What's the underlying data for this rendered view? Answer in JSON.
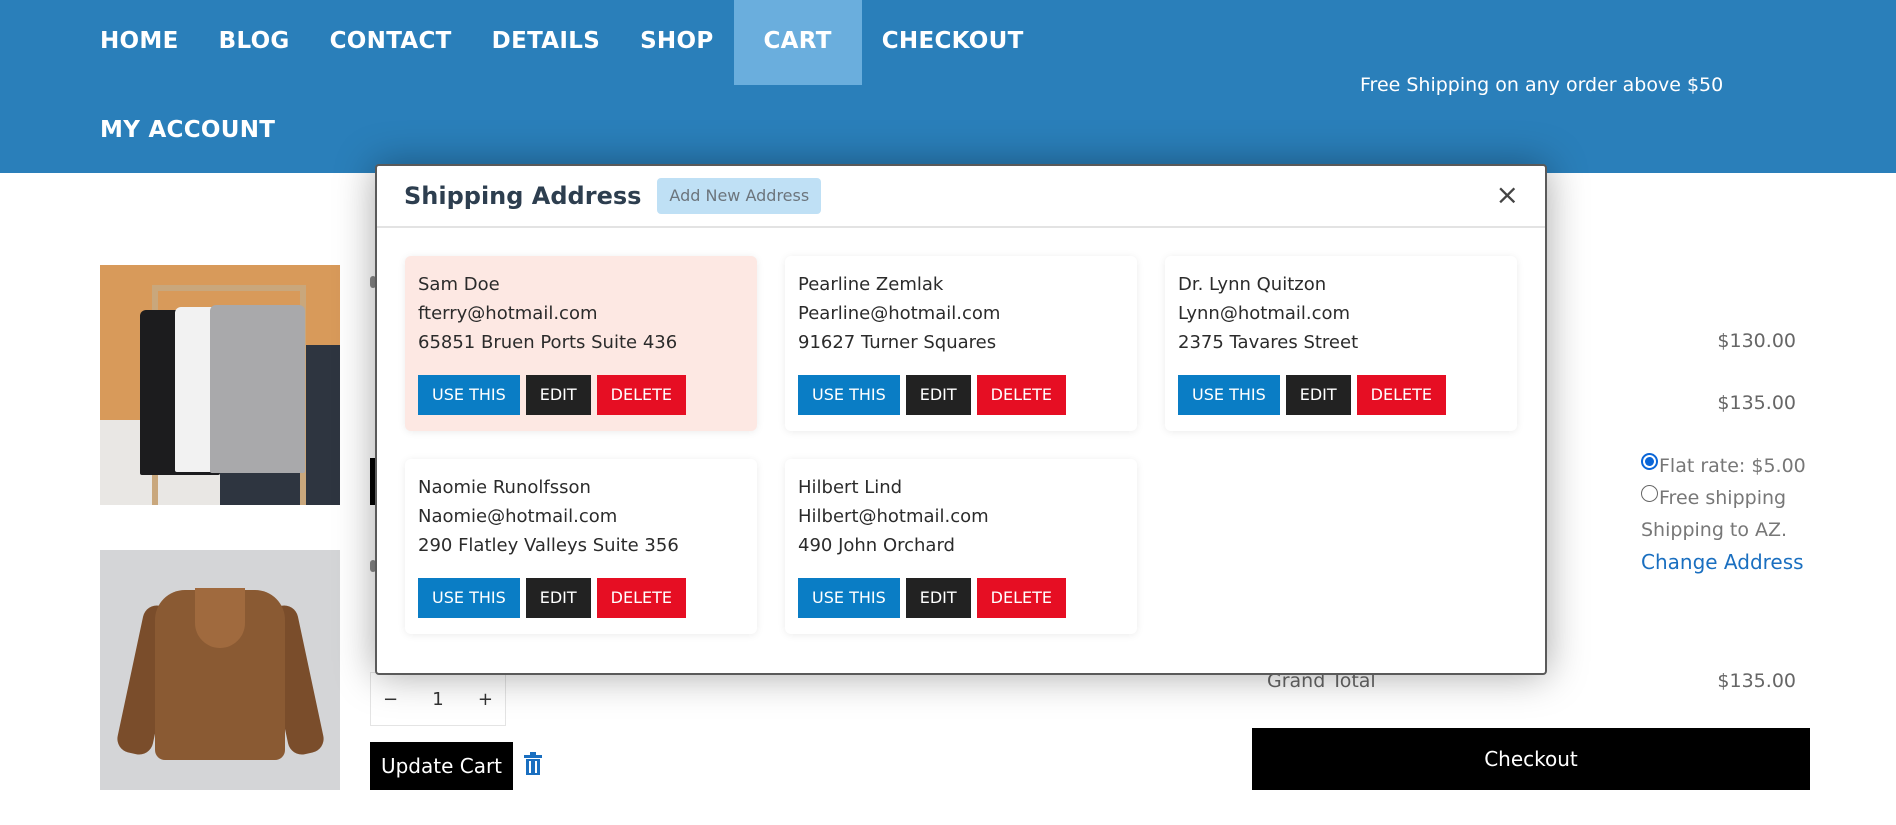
{
  "nav": {
    "items": [
      "HOME",
      "BLOG",
      "CONTACT",
      "DETAILS",
      "SHOP",
      "CART",
      "CHECKOUT"
    ],
    "active": "CART",
    "row2": "MY ACCOUNT"
  },
  "banner": "Free Shipping on any order above $50",
  "cart": {
    "prices": [
      "$130.00",
      "$135.00"
    ],
    "shipping_options": [
      "Flat rate: $5.00",
      "Free shipping"
    ],
    "shipping_to": "Shipping to AZ.",
    "change_address": "Change Address",
    "grand_total_label": "Grand Total",
    "grand_total_value": "$135.00",
    "checkout": "Checkout",
    "quantity": "1",
    "qty_minus": "−",
    "qty_plus": "+",
    "update_cart": "Update Cart"
  },
  "modal": {
    "title": "Shipping Address",
    "add_new": "Add New Address",
    "close": "×",
    "buttons": {
      "use": "USE THIS",
      "edit": "EDIT",
      "delete": "DELETE"
    },
    "addresses": [
      {
        "name": "Sam Doe",
        "email": "fterry@hotmail.com",
        "street": "65851 Bruen Ports Suite 436",
        "selected": true
      },
      {
        "name": "Pearline Zemlak",
        "email": "Pearline@hotmail.com",
        "street": "91627 Turner Squares",
        "selected": false
      },
      {
        "name": "Dr. Lynn Quitzon",
        "email": "Lynn@hotmail.com",
        "street": "2375 Tavares Street",
        "selected": false
      },
      {
        "name": "Naomie Runolfsson",
        "email": "Naomie@hotmail.com",
        "street": "290 Flatley Valleys Suite 356",
        "selected": false
      },
      {
        "name": "Hilbert Lind",
        "email": "Hilbert@hotmail.com",
        "street": "490 John Orchard",
        "selected": false
      }
    ]
  },
  "colors": {
    "header": "#2a7fba",
    "active_nav": "#6aaedd",
    "use_button": "#0a7dc5",
    "edit_button": "#222222",
    "delete_button": "#e60e23",
    "selected_card": "#fde8e3"
  }
}
